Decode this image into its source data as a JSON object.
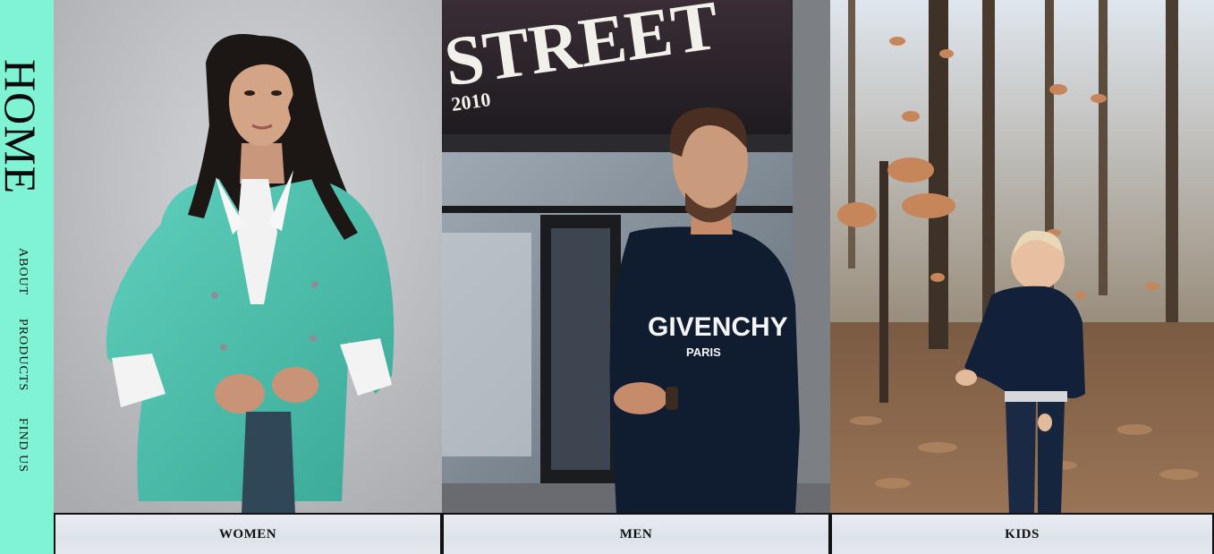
{
  "sidebar": {
    "home": "HOME",
    "nav": [
      {
        "label": "ABOUT"
      },
      {
        "label": "PRODUCTS"
      },
      {
        "label": "FIND US"
      }
    ]
  },
  "panels": [
    {
      "label": "WOMEN"
    },
    {
      "label": "MEN",
      "sign": "STREET",
      "sign_year": "2010",
      "shirt_brand": "GIVENCHY",
      "shirt_sub": "PARIS"
    },
    {
      "label": "KIDS"
    }
  ],
  "colors": {
    "sidebar": "#7ff3d4",
    "blazer": "#4fc3b0",
    "sweater": "#101c30"
  }
}
